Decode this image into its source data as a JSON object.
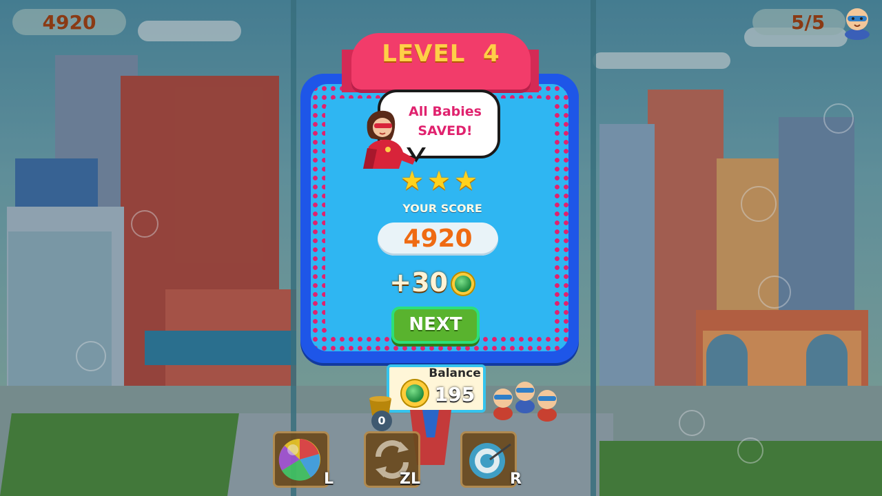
{
  "hud": {
    "score": "4920",
    "babies_counter": "5/5"
  },
  "level_banner": {
    "text": "LEVEL  4"
  },
  "dialog": {
    "speech": "All Babies SAVED!",
    "stars_earned": 3,
    "stars_total": 3,
    "score_label": "YOUR SCORE",
    "score_value": "4920",
    "reward": "+30",
    "next_label": "NEXT"
  },
  "balance": {
    "label": "Balance",
    "value": "195"
  },
  "powerups": [
    {
      "name": "color-ball",
      "key": "L"
    },
    {
      "name": "swap",
      "key": "ZL"
    },
    {
      "name": "target",
      "key": "R"
    }
  ],
  "shooter_counter": "0",
  "colors": {
    "panel_blue": "#1e56e8",
    "panel_inner": "#2fb6f2",
    "ribbon": "#f23c6a",
    "dots": "#e0226e",
    "next_green": "#59b32e",
    "score_orange": "#ef6a12"
  }
}
